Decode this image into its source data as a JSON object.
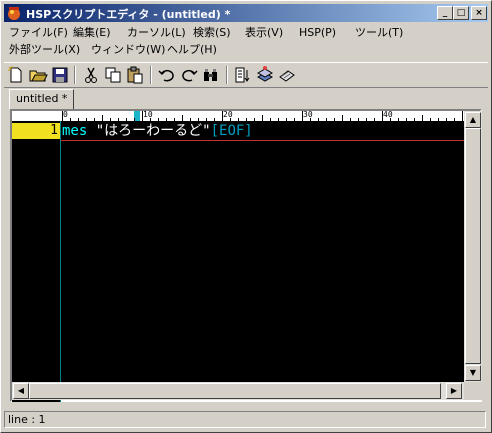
{
  "window": {
    "title": "HSPスクリプトエディタ - (untitled) *",
    "minimize": "_",
    "maximize": "□",
    "close": "×"
  },
  "menu": {
    "file": "ファイル(F)",
    "edit": "編集(E)",
    "cursor": "カーソル(L)",
    "search": "検索(S)",
    "view": "表示(V)",
    "hsp": "HSP(P)",
    "tool": "ツール(T)",
    "external_tool": "外部ツール(X)",
    "window": "ウィンドウ(W)",
    "help": "ヘルプ(H)"
  },
  "tab": {
    "label": "untitled *"
  },
  "ruler": {
    "marks": [
      "0",
      "10",
      "20",
      "30",
      "40"
    ]
  },
  "editor": {
    "line_number": "1",
    "keyword": "mes",
    "string": "\"はろーわーるど\"",
    "eof": "[EOF]"
  },
  "status": {
    "line": "line : 1"
  },
  "colors": {
    "background": "#000000",
    "keyword": "#00ffff",
    "string": "#ffffff",
    "eof": "#00a0c0",
    "line_number_bg": "#f0e020",
    "cursor_line": "#c03030",
    "title_gradient_start": "#0a246a"
  }
}
